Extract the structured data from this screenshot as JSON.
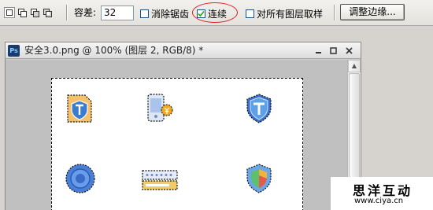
{
  "options_bar": {
    "selection_modes": [
      "new-selection-icon",
      "add-to-selection-icon",
      "subtract-from-selection-icon",
      "intersect-selection-icon"
    ],
    "tolerance_label": "容差:",
    "tolerance_value": "32",
    "antialias_label": "消除锯齿",
    "antialias_checked": false,
    "contiguous_label": "连续",
    "contiguous_checked": true,
    "sample_all_layers_label": "对所有图层取样",
    "sample_all_layers_checked": false,
    "refine_edge_label": "调整边缘...",
    "highlight_color": "#e02020"
  },
  "document": {
    "title": "安全3.0.png @ 100% (图层 2, RGB/8) *",
    "app_icon_label": "Ps",
    "icons": [
      "document-shield-icon",
      "phone-payment-icon",
      "shield-icon",
      "globe-button-icon",
      "password-field-icon",
      "color-shield-icon"
    ]
  },
  "watermark": {
    "text": "思洋互动",
    "url": "www.ciya.cn"
  }
}
